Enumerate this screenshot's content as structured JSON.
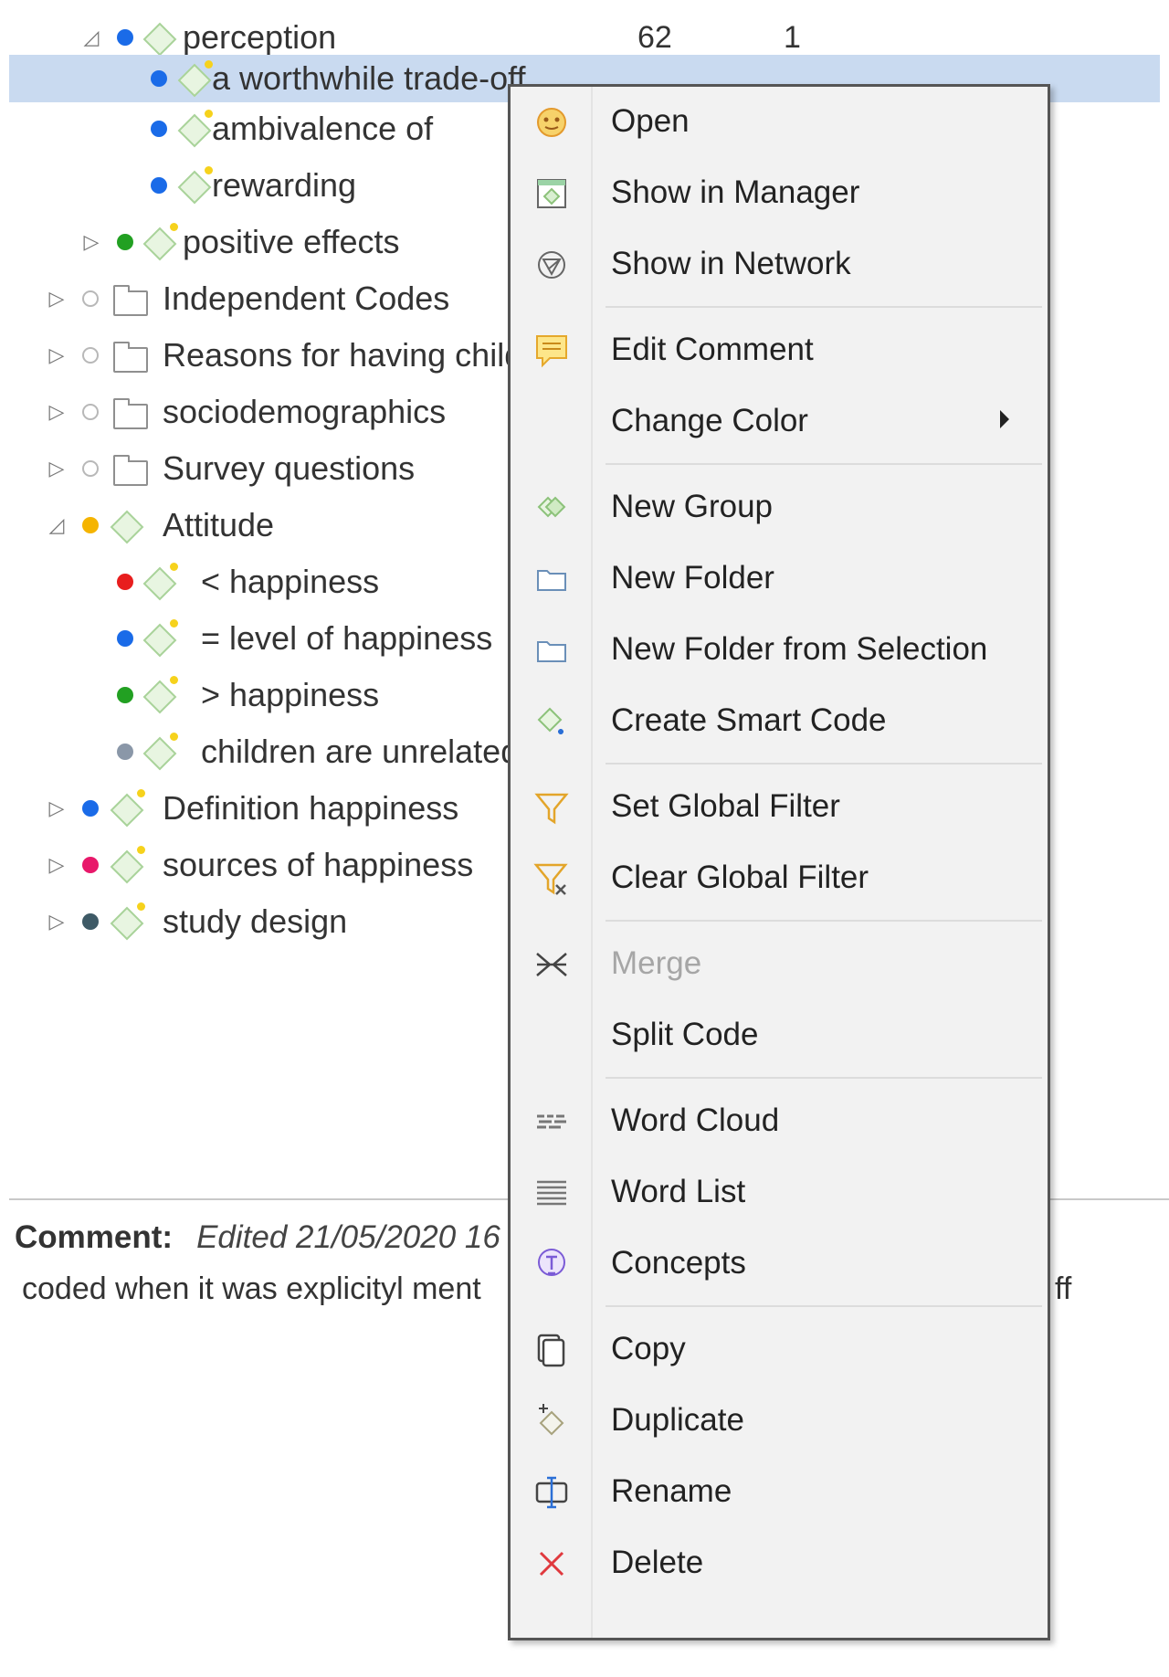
{
  "tree": [
    {
      "name": "tree-row-perception",
      "label": "perception",
      "twisty": "◿",
      "dot": "#1a6be8",
      "kind": "group",
      "col1": "62",
      "col2": "1"
    },
    {
      "name": "tree-row-a-worthwhile-trade",
      "label": "a worthwhile trade-off",
      "dot": "#1a6be8",
      "kind": "code",
      "selected": true
    },
    {
      "name": "tree-row-ambivalence-of",
      "label": "ambivalence of",
      "dot": "#1a6be8",
      "kind": "code"
    },
    {
      "name": "tree-row-rewarding",
      "label": "rewarding",
      "dot": "#1a6be8",
      "kind": "code"
    },
    {
      "name": "tree-row-positive-effects",
      "label": "positive effects",
      "twisty": "▷",
      "dot": "#22a022",
      "kind": "code"
    },
    {
      "name": "tree-row-independent-codes",
      "label": "Independent Codes",
      "twisty": "▷",
      "dot": "hollow",
      "kind": "folder"
    },
    {
      "name": "tree-row-reasons-for-having-children",
      "label": "Reasons for having children",
      "twisty": "▷",
      "dot": "hollow",
      "kind": "folder"
    },
    {
      "name": "tree-row-sociodemographics",
      "label": "sociodemographics",
      "twisty": "▷",
      "dot": "hollow",
      "kind": "folder"
    },
    {
      "name": "tree-row-survey-questions",
      "label": "Survey questions",
      "twisty": "▷",
      "dot": "hollow",
      "kind": "folder"
    },
    {
      "name": "tree-row-attitude",
      "label": "Attitude",
      "twisty": "◿",
      "dot": "#f5b400",
      "kind": "group"
    },
    {
      "name": "tree-row-less-happiness",
      "label": "< happiness",
      "dot": "#e81e1e",
      "kind": "code"
    },
    {
      "name": "tree-row-level-of-happiness",
      "label": "= level of happiness",
      "dot": "#1a6be8",
      "kind": "code"
    },
    {
      "name": "tree-row-more-happiness",
      "label": "> happiness",
      "dot": "#22a022",
      "kind": "code"
    },
    {
      "name": "tree-row-children-unrelated",
      "label": "children are unrelated",
      "dot": "#8a97a8",
      "kind": "code"
    },
    {
      "name": "tree-row-definition-happiness",
      "label": "Definition happiness",
      "twisty": "▷",
      "dot": "#1a6be8",
      "kind": "code"
    },
    {
      "name": "tree-row-sources-of-happiness",
      "label": "sources of happiness",
      "twisty": "▷",
      "dot": "#e8186a",
      "kind": "code"
    },
    {
      "name": "tree-row-study-design",
      "label": "study design",
      "twisty": "▷",
      "dot": "#3e5a66",
      "kind": "code"
    }
  ],
  "comment": {
    "label": "Comment:",
    "edited": "Edited 21/05/2020 16",
    "body": "coded when it was explicityl ment",
    "tail": "ff"
  },
  "menu": [
    {
      "name": "menu-item-open",
      "label": "Open",
      "icon": "open-icon"
    },
    {
      "name": "menu-item-show-in-manager",
      "label": "Show in Manager",
      "icon": "manager-icon"
    },
    {
      "name": "menu-item-show-in-network",
      "label": "Show in Network",
      "icon": "network-icon",
      "sep_after": true
    },
    {
      "name": "menu-item-edit-comment",
      "label": "Edit Comment",
      "icon": "comment-icon"
    },
    {
      "name": "menu-item-change-color",
      "label": "Change Color",
      "icon": "",
      "submenu": true,
      "sep_after": true
    },
    {
      "name": "menu-item-new-group",
      "label": "New Group",
      "icon": "group-icon"
    },
    {
      "name": "menu-item-new-folder",
      "label": "New Folder",
      "icon": "folder-icon"
    },
    {
      "name": "menu-item-new-folder-from-selection",
      "label": "New Folder from Selection",
      "icon": "folder-icon"
    },
    {
      "name": "menu-item-create-smart-code",
      "label": "Create Smart Code",
      "icon": "smart-code-icon",
      "sep_after": true
    },
    {
      "name": "menu-item-set-global-filter",
      "label": "Set Global Filter",
      "icon": "filter-icon"
    },
    {
      "name": "menu-item-clear-global-filter",
      "label": "Clear Global Filter",
      "icon": "clear-filter-icon",
      "sep_after": true
    },
    {
      "name": "menu-item-merge",
      "label": "Merge",
      "icon": "merge-icon",
      "disabled": true
    },
    {
      "name": "menu-item-split-code",
      "label": "Split Code",
      "icon": "",
      "sep_after": true
    },
    {
      "name": "menu-item-word-cloud",
      "label": "Word Cloud",
      "icon": "word-cloud-icon"
    },
    {
      "name": "menu-item-word-list",
      "label": "Word List",
      "icon": "word-list-icon"
    },
    {
      "name": "menu-item-concepts",
      "label": "Concepts",
      "icon": "concepts-icon",
      "sep_after": true
    },
    {
      "name": "menu-item-copy",
      "label": "Copy",
      "icon": "copy-icon"
    },
    {
      "name": "menu-item-duplicate",
      "label": "Duplicate",
      "icon": "duplicate-icon"
    },
    {
      "name": "menu-item-rename",
      "label": "Rename",
      "icon": "rename-icon"
    },
    {
      "name": "menu-item-delete",
      "label": "Delete",
      "icon": "delete-icon"
    }
  ]
}
